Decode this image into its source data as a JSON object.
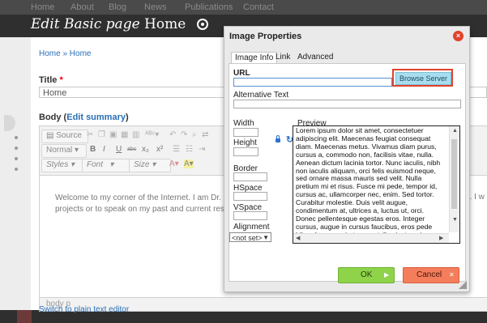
{
  "topnav": {
    "items": [
      "Home",
      "About",
      "Blog",
      "News",
      "Publications",
      "Contact"
    ]
  },
  "page": {
    "title_prefix": "Edit Basic page",
    "title_name": "Home"
  },
  "breadcrumb": "Home » Home",
  "title_field": {
    "label": "Title",
    "required_mark": "*",
    "value": "Home"
  },
  "body_field": {
    "label": "Body",
    "edit_summary": "Edit summary"
  },
  "toolbar": {
    "source": "Source",
    "format": "Normal",
    "font": "Font",
    "size": "Size",
    "bold": "B",
    "italic": "I",
    "underline": "U",
    "strike": "abc",
    "subscript": "x₂",
    "superscript": "x²"
  },
  "editor": {
    "line1": "Welcome to my corner of the Internet. I am Dr. Louise",
    "line2": "projects or to speak on my past and current research",
    "right_fragment": "e. I w"
  },
  "statusbar": "body  p",
  "plain_text_link": "Switch to plain text editor",
  "dialog": {
    "title": "Image Properties",
    "tabs": [
      "Image Info",
      "Link",
      "Advanced"
    ],
    "active_tab": "Image Info",
    "url_label": "URL",
    "url_value": "",
    "browse_button": "Browse Server",
    "alt_label": "Alternative Text",
    "alt_value": "",
    "width_label": "Width",
    "height_label": "Height",
    "border_label": "Border",
    "hspace_label": "HSpace",
    "vspace_label": "VSpace",
    "alignment_label": "Alignment",
    "alignment_value": "<not set>",
    "preview_label": "Preview",
    "preview_text": "Lorem ipsum dolor sit amet, consectetuer adipiscing elit. Maecenas feugiat consequat diam. Maecenas metus. Vivamus diam purus, cursus a, commodo non, facilisis vitae, nulla. Aenean dictum lacinia tortor. Nunc iaculis, nibh non iaculis aliquam, orci felis euismod neque, sed ornare massa mauris sed velit. Nulla pretium mi et risus. Fusce mi pede, tempor id, cursus ac, ullamcorper nec, enim. Sed tortor. Curabitur molestie. Duis velit augue, condimentum at, ultrices a, luctus ut, orci. Donec pellentesque egestas eros. Integer cursus, augue in cursus faucibus, eros pede bibendum sem, in tempus tellus justo quis ligula. Etiam eget",
    "ok_button": "OK",
    "cancel_button": "Cancel"
  },
  "colors": {
    "accent_blue": "#2a6fb6",
    "ok_green": "#8fd34a",
    "cancel_orange": "#f47d5c",
    "highlight_red": "#e0432b",
    "browse_blue": "#a7ddee"
  }
}
